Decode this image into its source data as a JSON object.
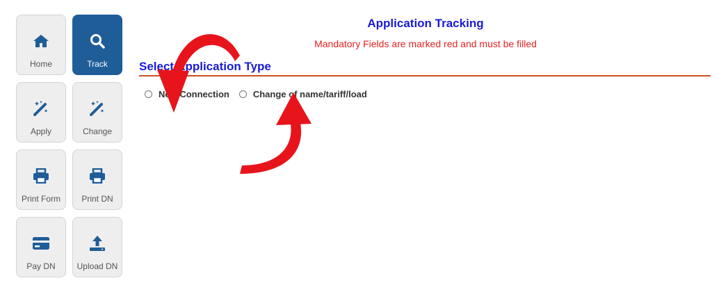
{
  "sidebar": {
    "items": [
      {
        "label": "Home",
        "icon": "home-icon"
      },
      {
        "label": "Track",
        "icon": "search-icon"
      },
      {
        "label": "Apply",
        "icon": "magic-wand-icon"
      },
      {
        "label": "Change",
        "icon": "magic-wand-icon"
      },
      {
        "label": "Print Form",
        "icon": "printer-icon"
      },
      {
        "label": "Print DN",
        "icon": "printer-icon"
      },
      {
        "label": "Pay DN",
        "icon": "credit-card-icon"
      },
      {
        "label": "Upload DN",
        "icon": "upload-icon"
      }
    ],
    "active_item": "Track"
  },
  "main": {
    "title": "Application Tracking",
    "subtitle": "Mandatory Fields are marked red and must be filled",
    "section_heading": "Select Application Type",
    "radio_options": [
      {
        "label": "New Connection",
        "checked": false
      },
      {
        "label": "Change of name/tariff/load",
        "checked": false
      }
    ]
  },
  "colors": {
    "title_blue": "#1a1ad6",
    "warning_red": "#e52222",
    "active_nav": "#1f5d99",
    "icon_blue": "#1f5d99",
    "divider": "#c8521f",
    "annotation_arrow": "#e8141b"
  }
}
